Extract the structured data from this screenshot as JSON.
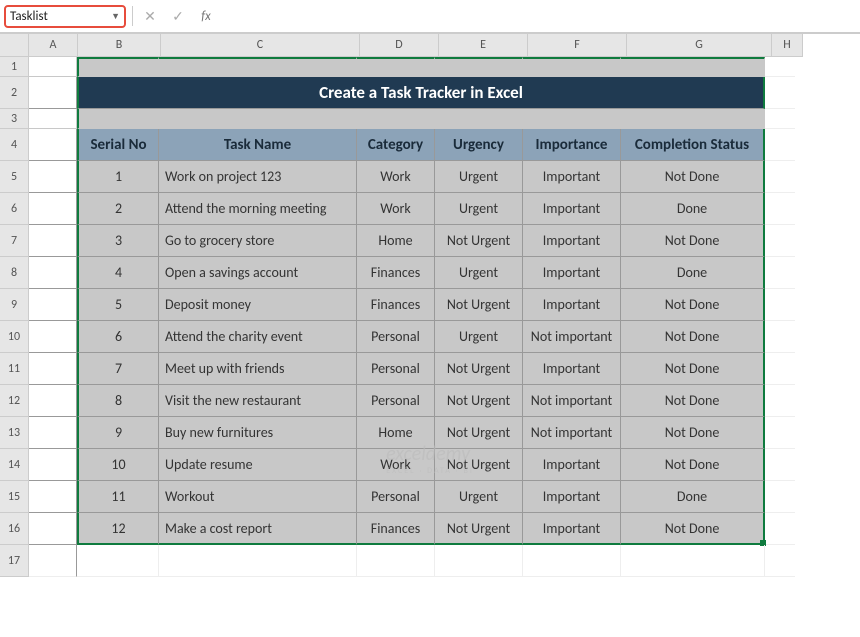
{
  "nameBox": "Tasklist",
  "cols": [
    "A",
    "B",
    "C",
    "D",
    "E",
    "F",
    "G",
    "H"
  ],
  "rows": [
    "1",
    "2",
    "3",
    "4",
    "5",
    "6",
    "7",
    "8",
    "9",
    "10",
    "11",
    "12",
    "13",
    "14",
    "15",
    "16",
    "17"
  ],
  "title": "Create a Task Tracker in Excel",
  "headers": {
    "b": "Serial No",
    "c": "Task Name",
    "d": "Category",
    "e": "Urgency",
    "f": "Importance",
    "g": "Completion Status"
  },
  "data": [
    {
      "no": "1",
      "task": "Work on project 123",
      "cat": "Work",
      "urg": "Urgent",
      "imp": "Important",
      "stat": "Not Done"
    },
    {
      "no": "2",
      "task": "Attend the morning meeting",
      "cat": "Work",
      "urg": "Urgent",
      "imp": "Important",
      "stat": "Done"
    },
    {
      "no": "3",
      "task": "Go to grocery store",
      "cat": "Home",
      "urg": "Not Urgent",
      "imp": "Important",
      "stat": "Not Done"
    },
    {
      "no": "4",
      "task": "Open a savings account",
      "cat": "Finances",
      "urg": "Urgent",
      "imp": "Important",
      "stat": "Done"
    },
    {
      "no": "5",
      "task": "Deposit money",
      "cat": "Finances",
      "urg": "Not Urgent",
      "imp": "Important",
      "stat": "Not Done"
    },
    {
      "no": "6",
      "task": "Attend the charity event",
      "cat": "Personal",
      "urg": "Urgent",
      "imp": "Not important",
      "stat": "Not Done"
    },
    {
      "no": "7",
      "task": "Meet up with friends",
      "cat": "Personal",
      "urg": "Not Urgent",
      "imp": "Important",
      "stat": "Not Done"
    },
    {
      "no": "8",
      "task": "Visit the new restaurant",
      "cat": "Personal",
      "urg": "Not Urgent",
      "imp": "Not important",
      "stat": "Not Done"
    },
    {
      "no": "9",
      "task": "Buy new furnitures",
      "cat": "Home",
      "urg": "Not Urgent",
      "imp": "Not important",
      "stat": "Not Done"
    },
    {
      "no": "10",
      "task": "Update resume",
      "cat": "Work",
      "urg": "Not Urgent",
      "imp": "Important",
      "stat": "Not Done"
    },
    {
      "no": "11",
      "task": "Workout",
      "cat": "Personal",
      "urg": "Urgent",
      "imp": "Important",
      "stat": "Done"
    },
    {
      "no": "12",
      "task": "Make a cost report",
      "cat": "Finances",
      "urg": "Not Urgent",
      "imp": "Important",
      "stat": "Not Done"
    }
  ],
  "watermark": {
    "main": "exceldemy",
    "sub": "EXCEL · DATA · BI"
  }
}
